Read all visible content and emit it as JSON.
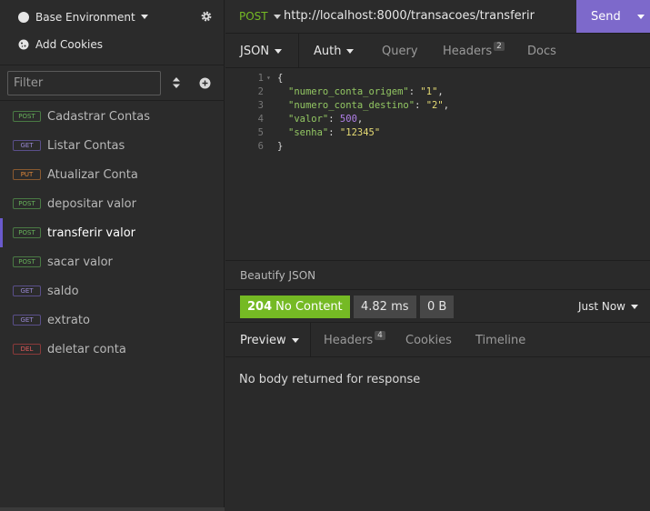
{
  "sidebar": {
    "environment_label": "Base Environment",
    "cookies_label": "Add Cookies",
    "filter_placeholder": "Filter",
    "requests": [
      {
        "method": "POST",
        "name": "Cadastrar Contas"
      },
      {
        "method": "GET",
        "name": "Listar Contas"
      },
      {
        "method": "PUT",
        "name": "Atualizar Conta"
      },
      {
        "method": "POST",
        "name": "depositar valor"
      },
      {
        "method": "POST",
        "name": "transferir valor"
      },
      {
        "method": "POST",
        "name": "sacar valor"
      },
      {
        "method": "GET",
        "name": "saldo"
      },
      {
        "method": "GET",
        "name": "extrato"
      },
      {
        "method": "DEL",
        "name": "deletar conta"
      }
    ]
  },
  "urlbar": {
    "method": "POST",
    "url": "http://localhost:8000/transacoes/transferir",
    "send_label": "Send"
  },
  "request_tabs": {
    "body": "JSON",
    "auth": "Auth",
    "query": "Query",
    "headers": "Headers",
    "headers_count": "2",
    "docs": "Docs"
  },
  "editor": {
    "line_numbers": [
      "1",
      "2",
      "3",
      "4",
      "5",
      "6"
    ],
    "open_brace": "{",
    "close_brace": "}",
    "fields": [
      {
        "key": "\"numero_conta_origem\"",
        "value": "\"1\"",
        "comma": ","
      },
      {
        "key": "\"numero_conta_destino\"",
        "value": "\"2\"",
        "comma": ","
      },
      {
        "key": "\"valor\"",
        "value": "500",
        "comma": ","
      },
      {
        "key": "\"senha\"",
        "value": "\"12345\"",
        "comma": ""
      }
    ]
  },
  "beautify_label": "Beautify JSON",
  "response": {
    "status_code": "204",
    "status_text": "No Content",
    "time": "4.82 ms",
    "size": "0 B",
    "timestamp": "Just Now",
    "tabs": {
      "preview": "Preview",
      "headers": "Headers",
      "headers_count": "4",
      "cookies": "Cookies",
      "timeline": "Timeline"
    },
    "body_message": "No body returned for response"
  },
  "colors": {
    "accent": "#7d69cb",
    "success": "#75ba24",
    "post": "#67b35a",
    "get": "#9a8ad6",
    "put": "#e0883a",
    "delete": "#e05a5a"
  }
}
